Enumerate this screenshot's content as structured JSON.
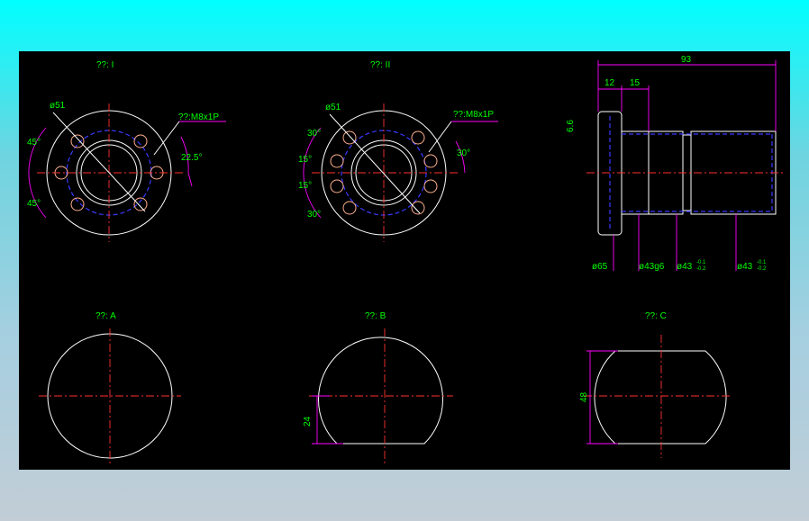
{
  "views": {
    "view1": {
      "caption": "??: I",
      "pitch_dia": "ø51",
      "thread": "??:M8x1P",
      "angle_top": "45°",
      "angle_bottom": "45°",
      "angle_right": "22.5°"
    },
    "view2": {
      "caption": "??: II",
      "pitch_dia": "ø51",
      "thread": "??:M8x1P",
      "angle_a": "30°",
      "angle_b": "15°",
      "angle_c": "15°",
      "angle_d": "30°",
      "angle_right": "30°"
    },
    "side": {
      "overall": "93",
      "flange_w": "12",
      "step_w": "15",
      "flange_t": "6.6",
      "d1": "ø65",
      "d2": "ø43g6",
      "d3_base": "ø43",
      "d3_tol_up": "-0.1",
      "d3_tol_dn": "-0.2",
      "d4_base": "ø43",
      "d4_tol_up": "-0.1",
      "d4_tol_dn": "-0.2"
    },
    "secA": {
      "caption": "??: A"
    },
    "secB": {
      "caption": "??: B",
      "dim": "24"
    },
    "secC": {
      "caption": "??: C",
      "dim": "48"
    }
  },
  "colors": {
    "background": "#000000",
    "outline": "#ffffff",
    "center": "#ff3030",
    "hidden": "#3a3aff",
    "dimension": "#ff00ff",
    "text": "#00ff00"
  }
}
